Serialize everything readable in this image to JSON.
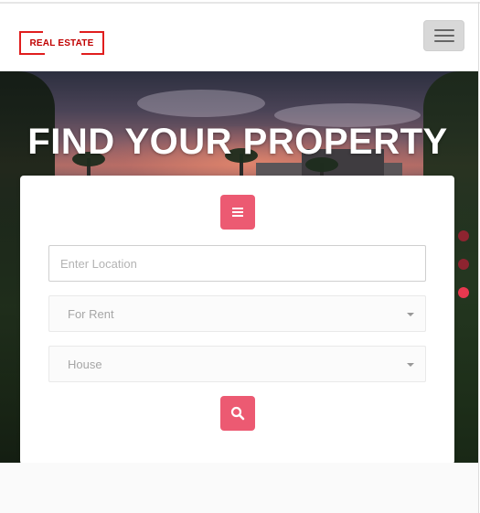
{
  "header": {
    "logo_text": "REAL ESTATE",
    "menu_icon": "hamburger-icon"
  },
  "hero": {
    "title": "FIND YOUR PROPERTY",
    "slider": {
      "dot_count": 3,
      "active_index": 2
    }
  },
  "search": {
    "list_button_icon": "list-icon",
    "location": {
      "placeholder": "Enter Location",
      "value": ""
    },
    "listing_type": {
      "selected": "For Rent"
    },
    "property_type": {
      "selected": "House"
    },
    "search_button_icon": "search-icon"
  },
  "colors": {
    "accent": "#ec5a72",
    "logo_red": "#e01e1e",
    "dot_active": "#e8384f",
    "dot_inactive": "#8e2430"
  }
}
